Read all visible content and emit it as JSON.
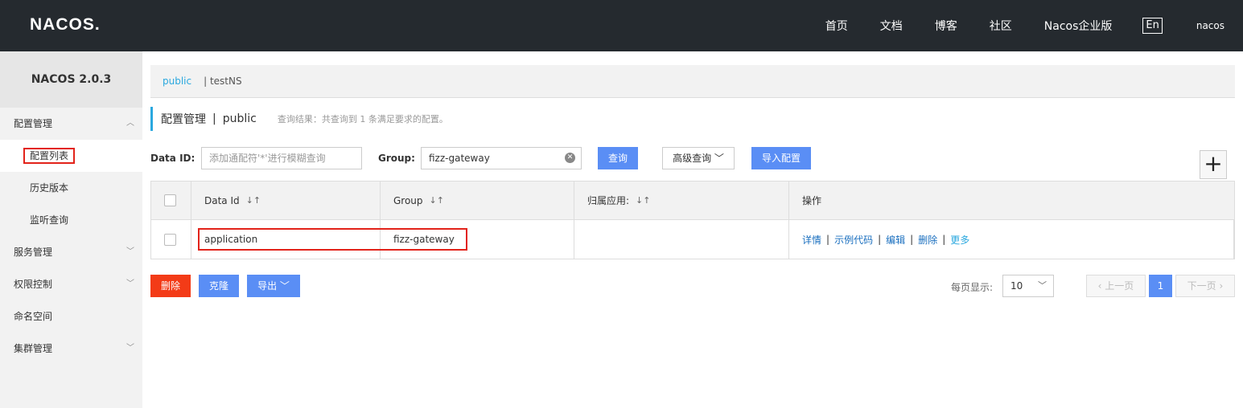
{
  "header": {
    "logo": "NACOS.",
    "nav": [
      "首页",
      "文档",
      "博客",
      "社区",
      "Nacos企业版"
    ],
    "lang": "En",
    "user": "nacos"
  },
  "sidebar": {
    "title": "NACOS 2.0.3",
    "config_group": "配置管理",
    "config_items": [
      "配置列表",
      "历史版本",
      "监听查询"
    ],
    "service_group": "服务管理",
    "auth_group": "权限控制",
    "namespace": "命名空间",
    "cluster_group": "集群管理"
  },
  "namespaces": {
    "active": "public",
    "other": "| testNS"
  },
  "page": {
    "title": "配置管理",
    "sep": "|",
    "ns": "public",
    "result_info": "查询结果：共查询到 1 条满足要求的配置。"
  },
  "filters": {
    "data_id_label": "Data ID:",
    "data_id_placeholder": "添加通配符'*'进行模糊查询",
    "group_label": "Group:",
    "group_value": "fizz-gateway",
    "query_button": "查询",
    "advanced_button": "高级查询",
    "import_button": "导入配置"
  },
  "table": {
    "headers": [
      "Data Id",
      "Group",
      "归属应用:",
      "操作"
    ],
    "rows": [
      {
        "data_id": "application",
        "group": "fizz-gateway",
        "app": ""
      }
    ],
    "ops": [
      "详情",
      "示例代码",
      "编辑",
      "删除",
      "更多"
    ]
  },
  "actions": {
    "delete": "删除",
    "clone": "克隆",
    "export": "导出"
  },
  "pagination": {
    "per_page_label": "每页显示:",
    "per_page_value": "10",
    "prev": "上一页",
    "current": "1",
    "next": "下一页"
  }
}
